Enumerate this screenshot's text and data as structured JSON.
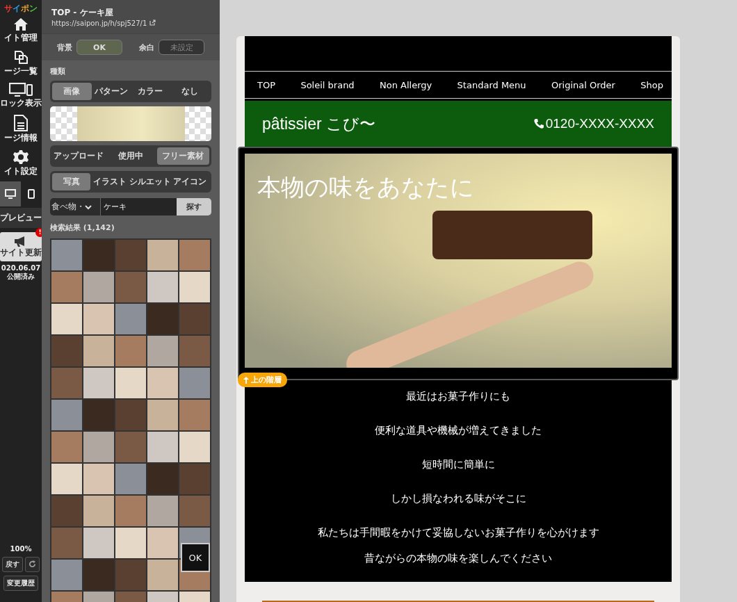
{
  "rail": {
    "logo": "サイポン",
    "items": [
      {
        "kind": "home",
        "label": "イト管理"
      },
      {
        "kind": "pages",
        "label": "ージ一覧"
      },
      {
        "kind": "devices",
        "label": "ロック表示"
      },
      {
        "kind": "document",
        "label": "ージ情報"
      },
      {
        "kind": "gear",
        "label": "イト設定"
      }
    ],
    "device_toggle": [
      {
        "kind": "desktop",
        "selected": true
      },
      {
        "kind": "mobile",
        "selected": false
      }
    ],
    "preview_label": "プレビュー",
    "update_button": {
      "label": "サイト更新",
      "badge": "!"
    },
    "date": "020.06.07",
    "status": "公開済み",
    "zoom": "100%",
    "undo": "戻す",
    "history": "変更履歴"
  },
  "panel": {
    "title": "TOP - ケーキ屋",
    "url": "https://saipon.jp/h/spj527/1",
    "background": {
      "label": "背景",
      "value": "OK"
    },
    "margin": {
      "label": "余白",
      "value": "未設定"
    },
    "type_label": "種類",
    "type_tabs": [
      {
        "label": "画像",
        "selected": true
      },
      {
        "label": "パターン",
        "selected": false
      },
      {
        "label": "カラー",
        "selected": false
      },
      {
        "label": "なし",
        "selected": false
      }
    ],
    "source_tabs": [
      {
        "label": "アップロード",
        "selected": false
      },
      {
        "label": "使用中",
        "selected": false
      },
      {
        "label": "フリー素材",
        "selected": true
      }
    ],
    "style_tabs": [
      {
        "label": "写真",
        "selected": true
      },
      {
        "label": "イラスト",
        "selected": false
      },
      {
        "label": "シルエット",
        "selected": false
      },
      {
        "label": "アイコン",
        "selected": false
      }
    ],
    "category": "食べ物・",
    "search": {
      "value": "ケーキ"
    },
    "search_button": "探す",
    "results_label": "検索結果 (1,142)",
    "ok_overlay": "OK"
  },
  "preview": {
    "nav": [
      "TOP",
      "Soleil brand",
      "Non Allergy",
      "Standard Menu",
      "Original Order",
      "Shop"
    ],
    "brand": "pâtissier こび〜",
    "phone": "0120-XXXX-XXXX",
    "hero_heading": "本物の味をあなたに",
    "breadcrumb": "上の階層",
    "lines": [
      "最近はお菓子作りにも",
      "便利な道具や機械が増えてきました",
      "短時間に簡単に",
      "しかし損なわれる味がそこに",
      "私たちは手間暇をかけて妥協しないお菓子作りを心がけます",
      "昔ながらの本物の味を楽しんでください"
    ]
  }
}
